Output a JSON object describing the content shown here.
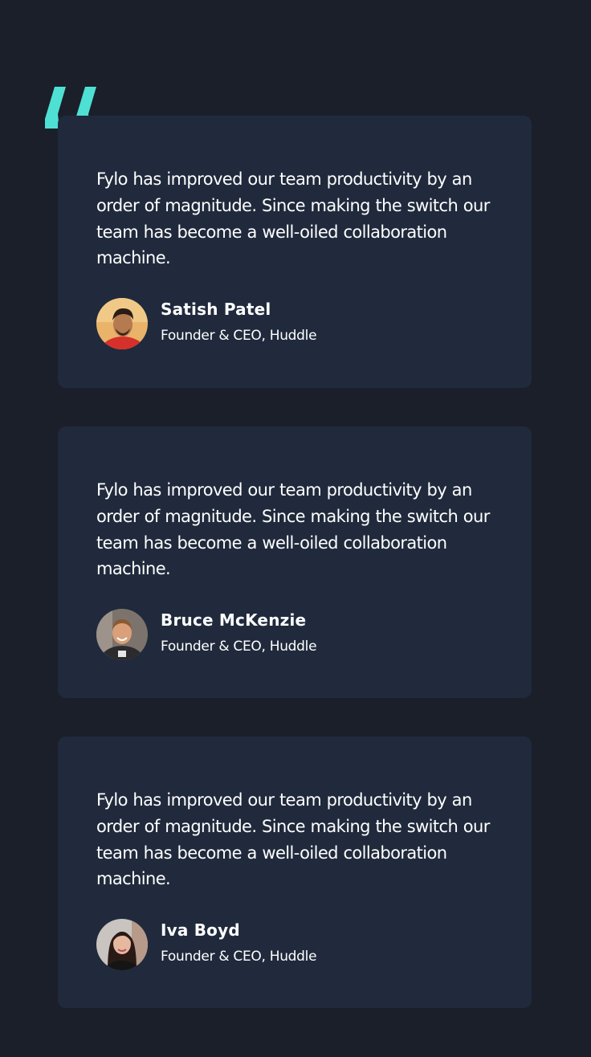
{
  "colors": {
    "page_background": "#1b1f2a",
    "card_background": "#202a3c",
    "quote_mark": "#4fe0d4",
    "text": "#ffffff"
  },
  "decoration": {
    "quote_icon": "quotation-mark-icon"
  },
  "testimonials": [
    {
      "quote": "Fylo has improved our team productivity by an order of magnitude. Since making the switch our team has become a well-oiled collaboration machine.",
      "name": "Satish Patel",
      "role": "Founder & CEO, Huddle",
      "avatar_icon": "avatar-satish-patel"
    },
    {
      "quote": "Fylo has improved our team productivity by an order of magnitude. Since making the switch our team has become a well-oiled collaboration machine.",
      "name": "Bruce McKenzie",
      "role": "Founder & CEO, Huddle",
      "avatar_icon": "avatar-bruce-mckenzie"
    },
    {
      "quote": "Fylo has improved our team productivity by an order of magnitude. Since making the switch our team has become a well-oiled collaboration machine.",
      "name": "Iva Boyd",
      "role": "Founder & CEO, Huddle",
      "avatar_icon": "avatar-iva-boyd"
    }
  ]
}
